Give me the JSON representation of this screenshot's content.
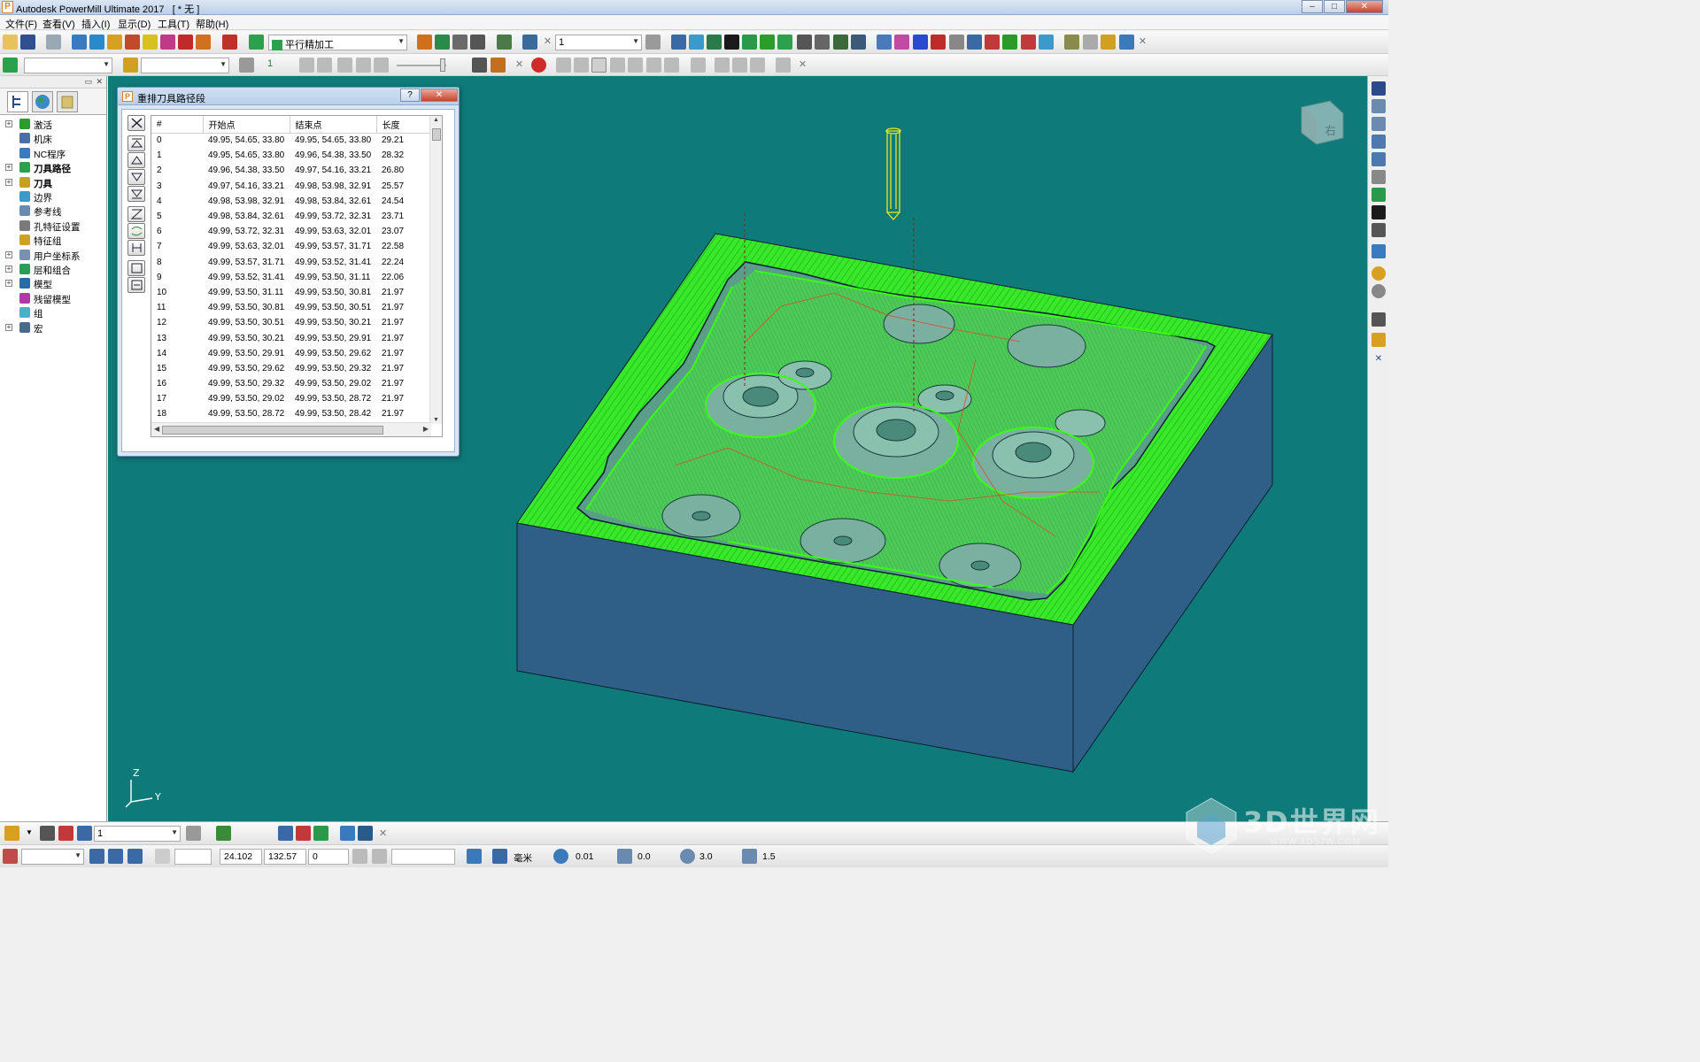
{
  "window": {
    "title": "Autodesk PowerMill Ultimate 2017   [ * 无 ]",
    "buttons": [
      "minimize",
      "maximize",
      "close"
    ]
  },
  "menu": [
    {
      "label": "文件(F)"
    },
    {
      "label": "查看(V)"
    },
    {
      "label": "插入(I)"
    },
    {
      "label": "显示(D)"
    },
    {
      "label": "工具(T)"
    },
    {
      "label": "帮助(H)"
    }
  ],
  "toolbar1": {
    "strategy_combo": "平行精加工",
    "number_combo": "1"
  },
  "toolbar2": {
    "combo_a": "",
    "combo_b": "",
    "step_value": "1"
  },
  "explorer": {
    "items": [
      {
        "label": "激活",
        "bold": false,
        "expandable": true,
        "icon": "arrow-icon",
        "color": "#2a9d2a"
      },
      {
        "label": "机床",
        "bold": false,
        "expandable": false,
        "icon": "machine-icon",
        "color": "#4a6fa5"
      },
      {
        "label": "NC程序",
        "bold": false,
        "expandable": false,
        "icon": "nc-program-icon",
        "color": "#3a7abf"
      },
      {
        "label": "刀具路径",
        "bold": true,
        "expandable": true,
        "icon": "toolpath-icon",
        "color": "#2aa14a"
      },
      {
        "label": "刀具",
        "bold": true,
        "expandable": true,
        "icon": "tool-icon",
        "color": "#c8a020"
      },
      {
        "label": "边界",
        "bold": false,
        "expandable": false,
        "icon": "boundary-icon",
        "color": "#3a9ac9"
      },
      {
        "label": "参考线",
        "bold": false,
        "expandable": false,
        "icon": "pattern-icon",
        "color": "#6a8ab0"
      },
      {
        "label": "孔特征设置",
        "bold": false,
        "expandable": false,
        "icon": "hole-feature-icon",
        "color": "#7a7a7a"
      },
      {
        "label": "特征组",
        "bold": false,
        "expandable": false,
        "icon": "feature-group-icon",
        "color": "#d0a020"
      },
      {
        "label": "用户坐标系",
        "bold": false,
        "expandable": true,
        "icon": "workplane-icon",
        "color": "#7a90b0"
      },
      {
        "label": "层和组合",
        "bold": false,
        "expandable": true,
        "icon": "level-icon",
        "color": "#2a9d5a"
      },
      {
        "label": "模型",
        "bold": false,
        "expandable": true,
        "icon": "model-icon",
        "color": "#2a6aa5"
      },
      {
        "label": "残留模型",
        "bold": false,
        "expandable": false,
        "icon": "stock-model-icon",
        "color": "#b03aa5"
      },
      {
        "label": "组",
        "bold": false,
        "expandable": false,
        "icon": "group-icon",
        "color": "#4ab0c9"
      },
      {
        "label": "宏",
        "bold": false,
        "expandable": true,
        "icon": "macro-icon",
        "color": "#4a6a8a"
      }
    ]
  },
  "dialog": {
    "title": "重排刀具路径段",
    "help_label": "?",
    "close_label": "✕",
    "columns": [
      "#",
      "开始点",
      "结束点",
      "长度"
    ],
    "rows": [
      [
        "0",
        "49.95, 54.65, 33.80",
        "49.95, 54.65, 33.80",
        "29.21"
      ],
      [
        "1",
        "49.95, 54.65, 33.80",
        "49.96, 54.38, 33.50",
        "28.32"
      ],
      [
        "2",
        "49.96, 54.38, 33.50",
        "49.97, 54.16, 33.21",
        "26.80"
      ],
      [
        "3",
        "49.97, 54.16, 33.21",
        "49.98, 53.98, 32.91",
        "25.57"
      ],
      [
        "4",
        "49.98, 53.98, 32.91",
        "49.98, 53.84, 32.61",
        "24.54"
      ],
      [
        "5",
        "49.98, 53.84, 32.61",
        "49.99, 53.72, 32.31",
        "23.71"
      ],
      [
        "6",
        "49.99, 53.72, 32.31",
        "49.99, 53.63, 32.01",
        "23.07"
      ],
      [
        "7",
        "49.99, 53.63, 32.01",
        "49.99, 53.57, 31.71",
        "22.58"
      ],
      [
        "8",
        "49.99, 53.57, 31.71",
        "49.99, 53.52, 31.41",
        "22.24"
      ],
      [
        "9",
        "49.99, 53.52, 31.41",
        "49.99, 53.50, 31.11",
        "22.06"
      ],
      [
        "10",
        "49.99, 53.50, 31.11",
        "49.99, 53.50, 30.81",
        "21.97"
      ],
      [
        "11",
        "49.99, 53.50, 30.81",
        "49.99, 53.50, 30.51",
        "21.97"
      ],
      [
        "12",
        "49.99, 53.50, 30.51",
        "49.99, 53.50, 30.21",
        "21.97"
      ],
      [
        "13",
        "49.99, 53.50, 30.21",
        "49.99, 53.50, 29.91",
        "21.97"
      ],
      [
        "14",
        "49.99, 53.50, 29.91",
        "49.99, 53.50, 29.62",
        "21.97"
      ],
      [
        "15",
        "49.99, 53.50, 29.62",
        "49.99, 53.50, 29.32",
        "21.97"
      ],
      [
        "16",
        "49.99, 53.50, 29.32",
        "49.99, 53.50, 29.02",
        "21.97"
      ],
      [
        "17",
        "49.99, 53.50, 29.02",
        "49.99, 53.50, 28.72",
        "21.97"
      ],
      [
        "18",
        "49.99, 53.50, 28.72",
        "49.99, 53.50, 28.42",
        "21.97"
      ]
    ]
  },
  "viewport": {
    "background": "#0f7a7a",
    "view_cube_label": "右",
    "axis_labels": {
      "z": "Z",
      "y": "Y"
    },
    "toolpath_color": "#39ff14",
    "stock_side_color": "#2f5f86"
  },
  "statusbar": {
    "toolbar_combo": "1",
    "coord_x": "24.102",
    "coord_y": "132.57",
    "coord_z": "0",
    "units": "毫米",
    "tolerance": "0.01",
    "thickness": "0.0",
    "tool_diameter": "3.0",
    "stepover": "1.5"
  },
  "watermark": {
    "text": "3D世界网",
    "url": "WWW.3DSJW.COM"
  }
}
